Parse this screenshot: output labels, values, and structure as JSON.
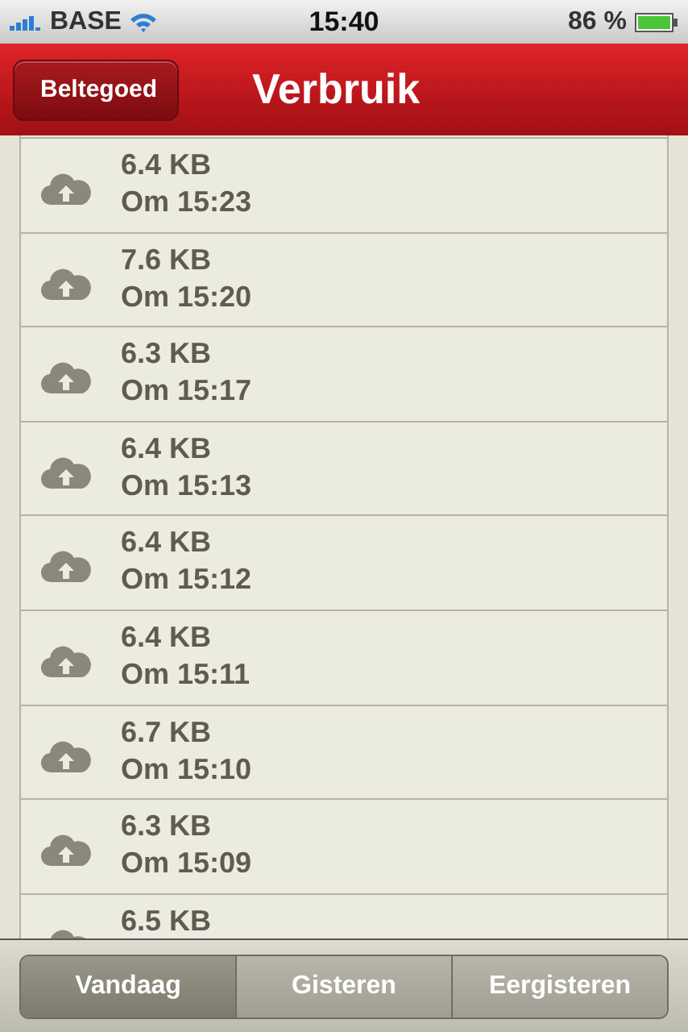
{
  "status_bar": {
    "carrier": "BASE",
    "time": "15:40",
    "battery": "86 %"
  },
  "nav_bar": {
    "back": "Beltegoed",
    "title": "Verbruik"
  },
  "rows": [
    {
      "size": "6.4 KB",
      "time": "Om 15:23"
    },
    {
      "size": "7.6 KB",
      "time": "Om 15:20"
    },
    {
      "size": "6.3 KB",
      "time": "Om 15:17"
    },
    {
      "size": "6.4 KB",
      "time": "Om 15:13"
    },
    {
      "size": "6.4 KB",
      "time": "Om 15:12"
    },
    {
      "size": "6.4 KB",
      "time": "Om 15:11"
    },
    {
      "size": "6.7 KB",
      "time": "Om 15:10"
    },
    {
      "size": "6.3 KB",
      "time": "Om 15:09"
    },
    {
      "size": "6.5 KB"
    }
  ],
  "segments": [
    {
      "label": "Vandaag",
      "selected": true
    },
    {
      "label": "Gisteren",
      "selected": false
    },
    {
      "label": "Eergisteren",
      "selected": false
    }
  ]
}
